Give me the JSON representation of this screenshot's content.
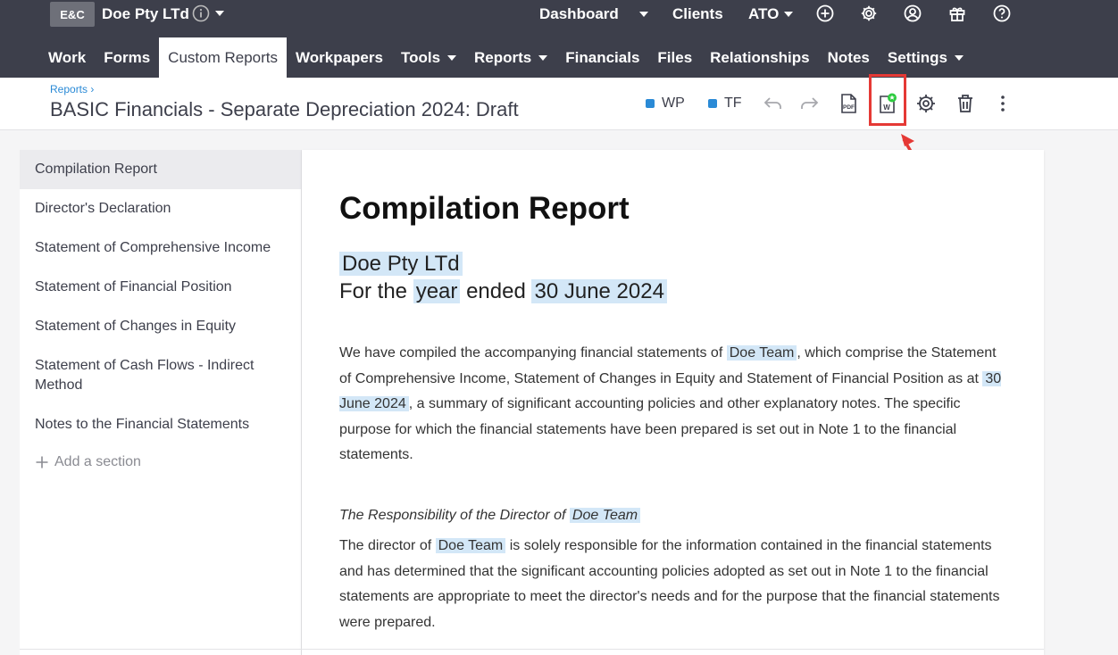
{
  "topbar": {
    "logo": "E&C",
    "client_name": "Doe Pty LTd",
    "nav": {
      "dashboard": "Dashboard",
      "clients": "Clients",
      "ato": "ATO"
    }
  },
  "mainnav": {
    "items": [
      {
        "label": "Work"
      },
      {
        "label": "Forms"
      },
      {
        "label": "Custom Reports"
      },
      {
        "label": "Workpapers"
      },
      {
        "label": "Tools"
      },
      {
        "label": "Reports"
      },
      {
        "label": "Financials"
      },
      {
        "label": "Files"
      },
      {
        "label": "Relationships"
      },
      {
        "label": "Notes"
      },
      {
        "label": "Settings"
      }
    ]
  },
  "header": {
    "breadcrumb": "Reports ›",
    "title": "BASIC Financials - Separate Depreciation 2024: Draft",
    "tags": [
      "WP",
      "TF"
    ]
  },
  "sidebar": {
    "items": [
      {
        "label": "Compilation Report"
      },
      {
        "label": "Director's Declaration"
      },
      {
        "label": "Statement of Comprehensive Income"
      },
      {
        "label": "Statement of Financial Position"
      },
      {
        "label": "Statement of Changes in Equity"
      },
      {
        "label": "Statement of Cash Flows - Indirect Method"
      },
      {
        "label": "Notes to the Financial Statements"
      }
    ],
    "add_section": "Add a section"
  },
  "doc": {
    "title": "Compilation Report",
    "entity": "Doe Pty LTd",
    "period_prefix": "For the",
    "period_word": "year",
    "period_mid": "ended",
    "period_date": "30 June 2024",
    "p1_a": "We have compiled the accompanying financial statements of",
    "p1_entity": "Doe Team",
    "p1_b": ", which comprise the Statement of Comprehensive Income, Statement of Changes in Equity and Statement of Financial Position as at",
    "p1_date": "30 June 2024",
    "p1_c": ", a summary of significant accounting policies and other explanatory notes. The specific purpose for which the financial statements have been prepared is set out in Note 1 to the financial statements.",
    "h2_a": "The Responsibility of the Director of",
    "h2_entity": "Doe Team",
    "p2_a": "The director of",
    "p2_entity": "Doe Team",
    "p2_b": "is solely responsible for the information contained in the financial statements and has determined that the significant accounting policies adopted as set out in Note 1 to the financial statements are appropriate to meet the director's needs and for the purpose that the financial statements were prepared."
  },
  "icons": {
    "info": "info-icon",
    "plus": "plus-circle-icon",
    "gear": "gear-icon",
    "user": "user-circle-icon",
    "gift": "gift-icon",
    "help": "help-icon",
    "undo": "undo-icon",
    "redo": "redo-icon",
    "pdf": "pdf-icon",
    "word": "word-export-icon",
    "trash": "trash-icon",
    "more": "more-icon"
  },
  "colors": {
    "topbar": "#3d3f4b",
    "accent": "#2a8ad6",
    "highlight": "#d3e7f7",
    "annotation": "#e53935"
  }
}
